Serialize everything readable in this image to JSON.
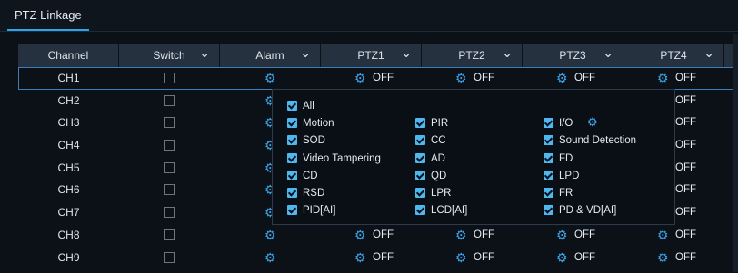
{
  "tab": {
    "label": "PTZ Linkage"
  },
  "columns": [
    {
      "label": "Channel",
      "chevron": false
    },
    {
      "label": "Switch",
      "chevron": true
    },
    {
      "label": "Alarm",
      "chevron": true
    },
    {
      "label": "PTZ1",
      "chevron": true
    },
    {
      "label": "PTZ2",
      "chevron": true
    },
    {
      "label": "PTZ3",
      "chevron": true
    },
    {
      "label": "PTZ4",
      "chevron": true
    }
  ],
  "rows": [
    "CH1",
    "CH2",
    "CH3",
    "CH4",
    "CH5",
    "CH6",
    "CH7",
    "CH8",
    "CH9"
  ],
  "off_label": "OFF",
  "popup": {
    "all_label": "All",
    "options": [
      [
        "Motion",
        "PIR",
        "I/O"
      ],
      [
        "SOD",
        "CC",
        "Sound Detection"
      ],
      [
        "Video Tampering",
        "AD",
        "FD"
      ],
      [
        "CD",
        "QD",
        "LPD"
      ],
      [
        "RSD",
        "LPR",
        "FR"
      ],
      [
        "PID[AI]",
        "LCD[AI]",
        "PD & VD[AI]"
      ]
    ]
  },
  "colors": {
    "accent": "#2ea3e6",
    "checkbox": "#4fb7ef",
    "header": "#25313f"
  }
}
